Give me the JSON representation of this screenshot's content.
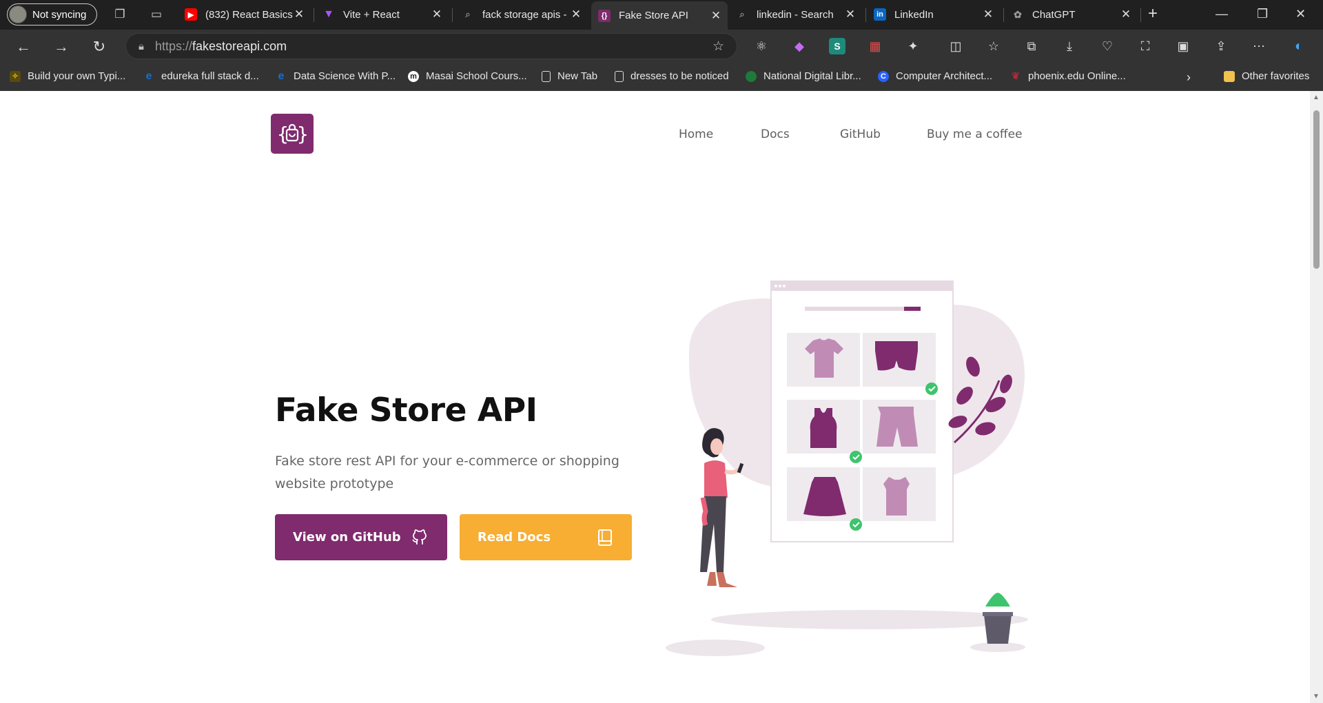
{
  "browser": {
    "profile_label": "Not syncing",
    "tabs": [
      {
        "title": "(832) React Basics",
        "favicon": "youtube-icon",
        "color": "#ff0000"
      },
      {
        "title": "Vite + React",
        "favicon": "vite-icon",
        "color": "#a855f7"
      },
      {
        "title": "fack storage apis -",
        "favicon": "search-icon",
        "color": "#555555"
      },
      {
        "title": "Fake Store API",
        "favicon": "fakestore-icon",
        "color": "#7f2b6e",
        "active": true
      },
      {
        "title": "linkedin - Search",
        "favicon": "search-icon",
        "color": "#555555"
      },
      {
        "title": "LinkedIn",
        "favicon": "linkedin-icon",
        "color": "#0a66c2"
      },
      {
        "title": "ChatGPT",
        "favicon": "chatgpt-icon",
        "color": "#777777"
      }
    ],
    "url_protocol": "https://",
    "url_host": "fakestoreapi.com",
    "bookmarks": [
      {
        "label": "Build your own Typi...",
        "icon": "typing-icon",
        "color": "#c8a400"
      },
      {
        "label": "edureka full stack d...",
        "icon": "edureka-icon",
        "color": "#1a6ec8"
      },
      {
        "label": "Data Science With P...",
        "icon": "edureka-icon",
        "color": "#1a6ec8"
      },
      {
        "label": "Masai School Cours...",
        "icon": "masai-icon",
        "color": "#ffffff"
      },
      {
        "label": "New Tab",
        "icon": "page-icon",
        "color": "#dddddd"
      },
      {
        "label": "dresses to be noticed",
        "icon": "page-icon",
        "color": "#dddddd"
      },
      {
        "label": "National Digital Libr...",
        "icon": "ndl-icon",
        "color": "#1e7a3a"
      },
      {
        "label": "Computer Architect...",
        "icon": "c-icon",
        "color": "#2962ff"
      },
      {
        "label": "phoenix.edu Online...",
        "icon": "phoenix-icon",
        "color": "#b0283c"
      }
    ],
    "other_favorites": "Other favorites"
  },
  "site": {
    "nav": [
      "Home",
      "Docs",
      "GitHub",
      "Buy me a coffee"
    ],
    "title": "Fake Store API",
    "subtitle": "Fake store rest API for your e-commerce or shopping website prototype",
    "github_button": "View on GitHub",
    "docs_button": "Read Docs",
    "colors": {
      "primary": "#7f2b6e",
      "accent": "#f7ae33",
      "text": "#111111"
    }
  }
}
